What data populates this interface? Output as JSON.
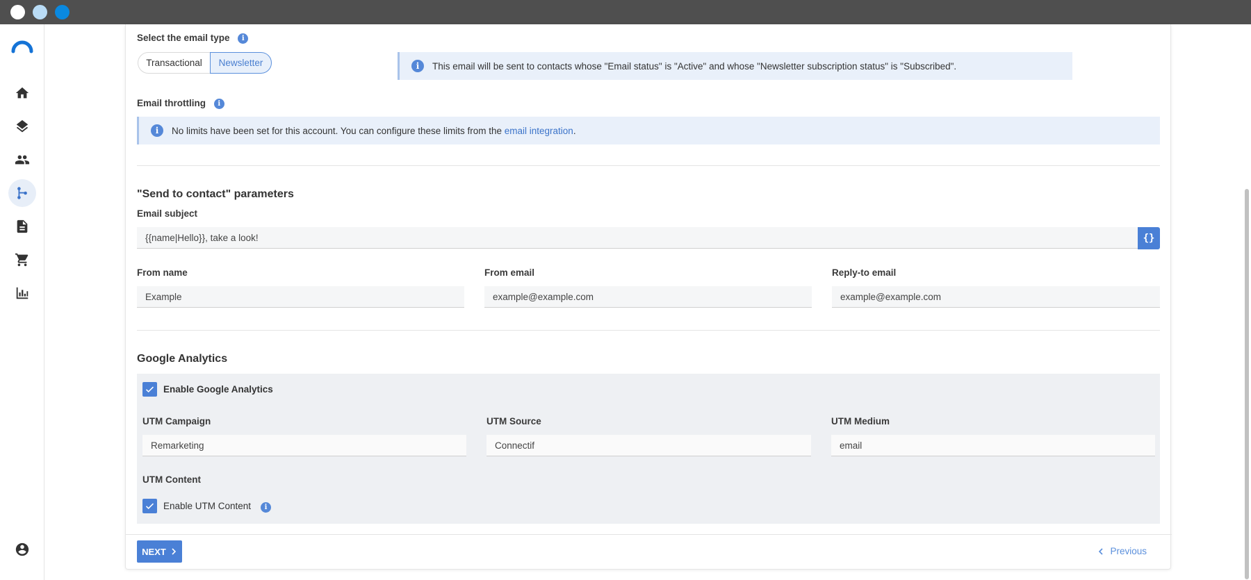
{
  "colors": {
    "accent": "#4a80d6",
    "titlebar": "#4f4f4f",
    "info_bg": "#e9f0fa",
    "panel_bg": "#eef0f3"
  },
  "sidebar": {
    "items": [
      {
        "icon": "home-icon"
      },
      {
        "icon": "layers-icon"
      },
      {
        "icon": "people-icon"
      },
      {
        "icon": "workflow-icon",
        "active": true
      },
      {
        "icon": "document-icon"
      },
      {
        "icon": "cart-icon"
      },
      {
        "icon": "bar-chart-icon"
      },
      {
        "icon": "account-icon"
      }
    ]
  },
  "email_type": {
    "label": "Select the email type",
    "options": [
      "Transactional",
      "Newsletter"
    ],
    "selected": "Newsletter",
    "notice": "This email will be sent to contacts whose \"Email status\" is \"Active\" and whose \"Newsletter subscription status\" is \"Subscribed\"."
  },
  "throttling": {
    "label": "Email throttling",
    "notice_prefix": "No limits have been set for this account. You can configure these limits from the ",
    "notice_link": "email integration",
    "notice_suffix": "."
  },
  "send_params": {
    "heading": "\"Send to contact\" parameters",
    "subject_label": "Email subject",
    "subject_value": "{{name|Hello}}, take a look!",
    "variable_button": "{}",
    "from_name_label": "From name",
    "from_name_value": "Example",
    "from_email_label": "From email",
    "from_email_value": "example@example.com",
    "reply_to_label": "Reply-to email",
    "reply_to_value": "example@example.com"
  },
  "analytics": {
    "heading": "Google Analytics",
    "enable_label": "Enable Google Analytics",
    "enabled": true,
    "campaign_label": "UTM Campaign",
    "campaign_value": "Remarketing",
    "source_label": "UTM Source",
    "source_value": "Connectif",
    "medium_label": "UTM Medium",
    "medium_value": "email",
    "content_label": "UTM Content",
    "content_enable_label": "Enable UTM Content",
    "content_enabled": true
  },
  "footer": {
    "next_label": "NEXT",
    "previous_label": "Previous"
  }
}
